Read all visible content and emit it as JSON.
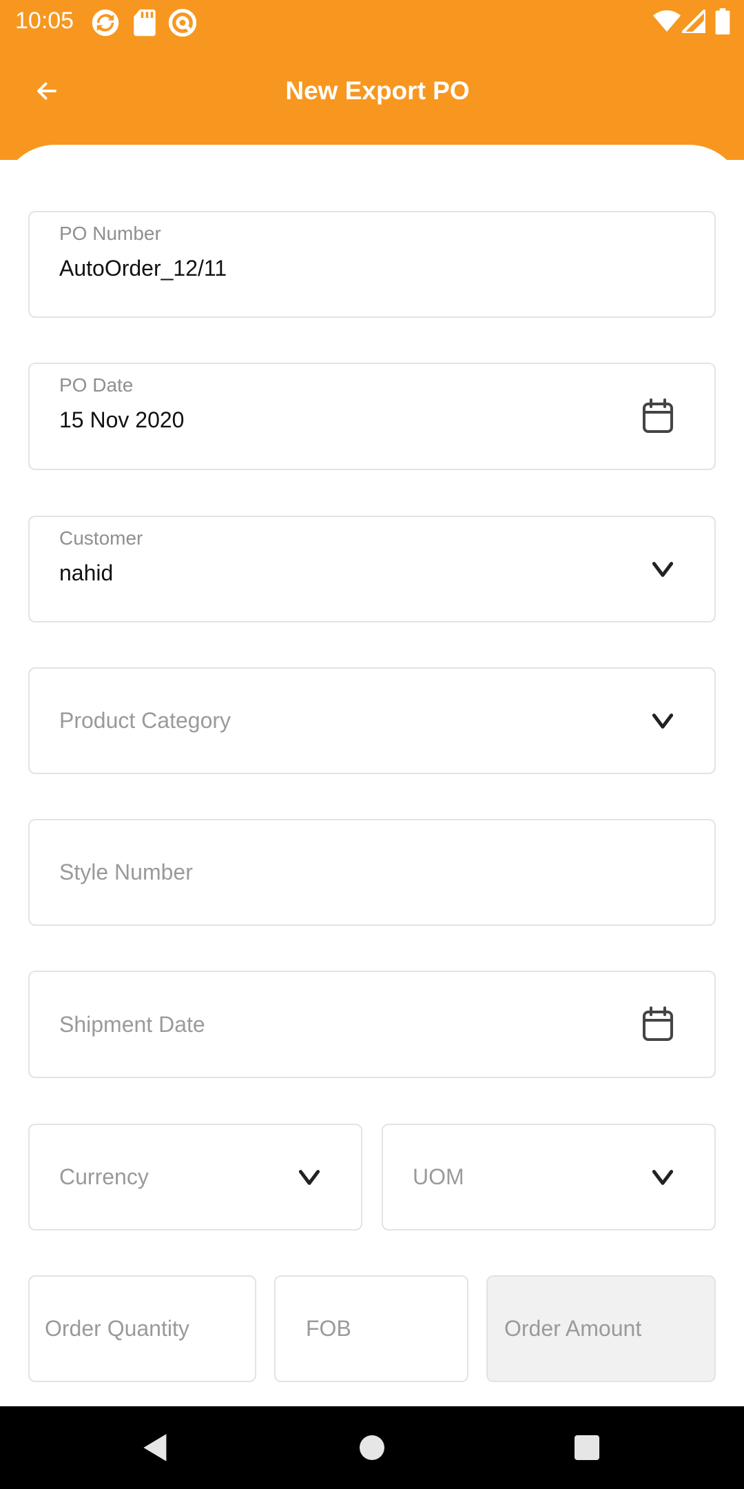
{
  "status_bar": {
    "time": "10:05",
    "left_icons": [
      "sync-icon",
      "sd-card-icon",
      "at-sign-icon"
    ],
    "right_icons": [
      "wifi-icon",
      "signal-icon",
      "battery-icon"
    ]
  },
  "app_bar": {
    "title": "New Export PO",
    "back_icon": "arrow-left-icon"
  },
  "form": {
    "po_number": {
      "label": "PO Number",
      "value": "AutoOrder_12/11"
    },
    "po_date": {
      "label": "PO Date",
      "value": "15 Nov 2020",
      "icon": "calendar-icon"
    },
    "customer": {
      "label": "Customer",
      "value": "nahid",
      "icon": "chevron-down-icon"
    },
    "product_category": {
      "placeholder": "Product Category",
      "icon": "chevron-down-icon"
    },
    "style_number": {
      "placeholder": "Style Number"
    },
    "shipment_date": {
      "placeholder": "Shipment Date",
      "icon": "calendar-icon"
    },
    "currency": {
      "placeholder": "Currency",
      "icon": "chevron-down-icon"
    },
    "uom": {
      "placeholder": "UOM",
      "icon": "chevron-down-icon"
    },
    "order_quantity": {
      "placeholder": "Order Quantity"
    },
    "fob": {
      "placeholder": "FOB"
    },
    "order_amount": {
      "placeholder": "Order Amount"
    }
  },
  "colors": {
    "accent": "#F7971F",
    "border": "#E3E3E3",
    "disabled_fill": "#F1F1F1",
    "nav_bar": "#000000"
  },
  "nav_bar": {
    "buttons": [
      "back-triangle-icon",
      "home-circle-icon",
      "recents-square-icon"
    ]
  }
}
